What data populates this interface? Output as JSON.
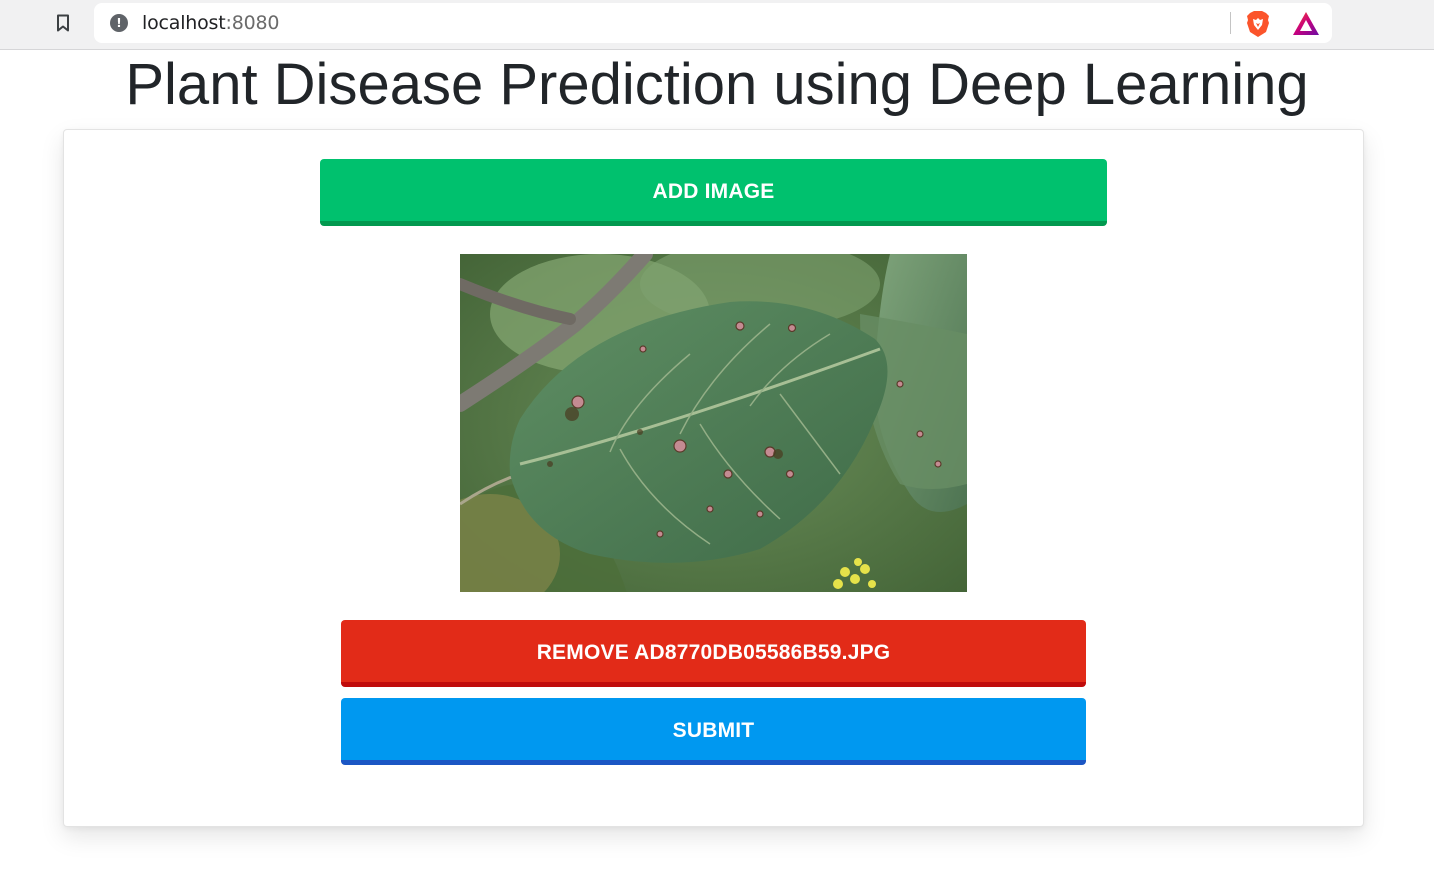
{
  "browser": {
    "url_host": "localhost",
    "url_port": ":8080"
  },
  "page": {
    "title": "Plant Disease Prediction using Deep Learning"
  },
  "uploader": {
    "add_label": "ADD IMAGE",
    "remove_label": "REMOVE AD8770DB05586B59.JPG",
    "submit_label": "SUBMIT"
  },
  "colors": {
    "add_button": "#00c16e",
    "remove_button": "#e22b18",
    "submit_button": "#0098f0"
  }
}
